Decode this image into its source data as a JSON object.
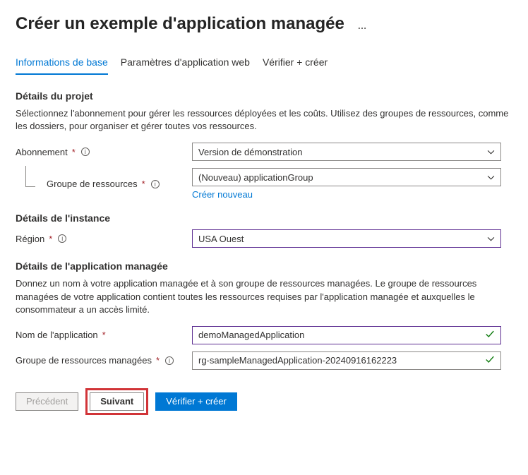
{
  "page": {
    "title": "Créer un exemple d'application managée",
    "more": "…"
  },
  "tabs": {
    "t0": "Informations de base",
    "t1": "Paramètres d'application web",
    "t2": "Vérifier + créer"
  },
  "project": {
    "title": "Détails du projet",
    "desc": "Sélectionnez l'abonnement pour gérer les ressources déployées et les coûts. Utilisez des groupes de ressources, comme les dossiers, pour organiser et gérer toutes vos ressources.",
    "subscription_label": "Abonnement",
    "subscription_value": "Version de démonstration",
    "rg_label": "Groupe de ressources",
    "rg_value": "(Nouveau) applicationGroup",
    "rg_create_new": "Créer nouveau"
  },
  "instance": {
    "title": "Détails de l'instance",
    "region_label": "Région",
    "region_value": "USA Ouest"
  },
  "managed": {
    "title": "Détails de l'application managée",
    "desc": "Donnez un nom à votre application managée et à son groupe de ressources managées. Le groupe de ressources managées de votre application contient toutes les ressources requises par l'application managée et auxquelles le consommateur a un accès limité.",
    "appname_label": "Nom de l'application",
    "appname_value": "demoManagedApplication",
    "mrg_label": "Groupe de ressources managées",
    "mrg_value": "rg-sampleManagedApplication-20240916162223"
  },
  "footer": {
    "prev": "Précédent",
    "next": "Suivant",
    "review": "Vérifier + créer"
  }
}
